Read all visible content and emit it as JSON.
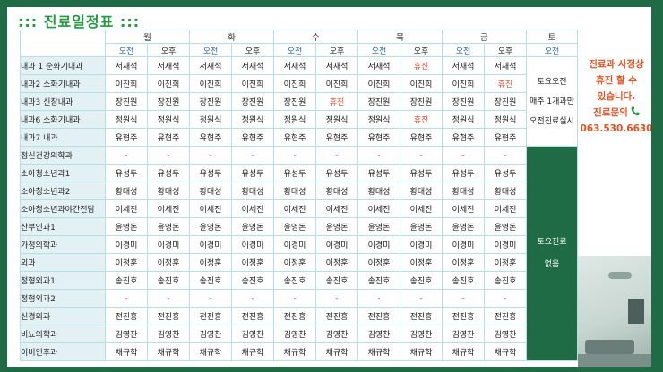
{
  "title": "::: 진료일정표 :::",
  "days": [
    "월",
    "화",
    "수",
    "목",
    "금",
    "토"
  ],
  "am_label": "오전",
  "pm_label": "오후",
  "off_label": "휴진",
  "rows": [
    {
      "dept": "내과 1 순화기내과",
      "cells": [
        "서재석",
        "서재석",
        "서재석",
        "서재석",
        "서재석",
        "서재석",
        "서재석",
        "휴진",
        "서재석",
        "서재석"
      ]
    },
    {
      "dept": "내과2 소화기내과",
      "cells": [
        "이진희",
        "이진희",
        "이진희",
        "이진희",
        "이진희",
        "이진희",
        "이진희",
        "이진희",
        "이진희",
        "휴진"
      ]
    },
    {
      "dept": "내과3 신장내과",
      "cells": [
        "장진원",
        "장진원",
        "장진원",
        "장진원",
        "장진원",
        "휴진",
        "장진원",
        "장진원",
        "장진원",
        "장진원"
      ]
    },
    {
      "dept": "내과6 소화기내과",
      "cells": [
        "정원식",
        "정원식",
        "정원식",
        "정원식",
        "정원식",
        "정원식",
        "정원식",
        "휴진",
        "정원식",
        "정원식"
      ]
    },
    {
      "dept": "내과7 내과",
      "cells": [
        "유형주",
        "유형주",
        "유형주",
        "유형주",
        "유형주",
        "유형주",
        "유형주",
        "유형주",
        "유형주",
        "유형주"
      ]
    },
    {
      "dept": "정신건강의학과",
      "cells": [
        "-",
        "-",
        "-",
        "-",
        "-",
        "-",
        "-",
        "-",
        "-",
        "-"
      ]
    },
    {
      "dept": "소아청소년과1",
      "cells": [
        "유성두",
        "유성두",
        "유성두",
        "유성두",
        "유성두",
        "유성두",
        "유성두",
        "유성두",
        "유성두",
        "유성두"
      ]
    },
    {
      "dept": "소아청소년과2",
      "cells": [
        "황대성",
        "황대성",
        "황대성",
        "황대성",
        "황대성",
        "황대성",
        "황대성",
        "황대성",
        "황대성",
        "황대성"
      ]
    },
    {
      "dept": "소아청소년과야간전담",
      "cells": [
        "이세진",
        "이세진",
        "이세진",
        "이세진",
        "이세진",
        "이세진",
        "이세진",
        "이세진",
        "이세진",
        "이세진"
      ]
    },
    {
      "dept": "산부인과1",
      "cells": [
        "윤영돈",
        "윤영돈",
        "윤영돈",
        "윤영돈",
        "윤영돈",
        "윤영돈",
        "윤영돈",
        "윤영돈",
        "윤영돈",
        "윤영돈"
      ]
    },
    {
      "dept": "가정의학과",
      "cells": [
        "이경미",
        "이경미",
        "이경미",
        "이경미",
        "이경미",
        "이경미",
        "이경미",
        "이경미",
        "이경미",
        "이경미"
      ]
    },
    {
      "dept": "외과",
      "cells": [
        "이정훈",
        "이정훈",
        "이정훈",
        "이정훈",
        "이정훈",
        "이정훈",
        "이정훈",
        "이정훈",
        "이정훈",
        "이정훈"
      ]
    },
    {
      "dept": "정형외과1",
      "cells": [
        "송진호",
        "송진호",
        "송진호",
        "송진호",
        "송진호",
        "송진호",
        "송진호",
        "송진호",
        "송진호",
        "송진호"
      ]
    },
    {
      "dept": "정형외과2",
      "cells": [
        "-",
        "-",
        "-",
        "-",
        "-",
        "-",
        "-",
        "-",
        "-",
        "-"
      ]
    },
    {
      "dept": "신경외과",
      "cells": [
        "전진흥",
        "전진흥",
        "전진흥",
        "전진흥",
        "전진흥",
        "전진흥",
        "전진흥",
        "전진흥",
        "전진흥",
        "전진흥"
      ]
    },
    {
      "dept": "비뇨의학과",
      "cells": [
        "김영찬",
        "김영찬",
        "김영찬",
        "김영찬",
        "김영찬",
        "김영찬",
        "김영찬",
        "김영찬",
        "김영찬",
        "김영찬"
      ]
    },
    {
      "dept": "이비인후과",
      "cells": [
        "채규학",
        "채규학",
        "채규학",
        "채규학",
        "채규학",
        "채규학",
        "채규학",
        "채규학",
        "채규학",
        "채규학"
      ]
    }
  ],
  "saturday_note_top": [
    "토요오전",
    "매주 1개과만",
    "오전진료실시"
  ],
  "saturday_note_bottom": [
    "토요진료",
    "없음"
  ],
  "side_note": [
    "진료과 사정상",
    "휴진 할 수",
    "있습니다.",
    "진료문의"
  ],
  "phone": "063.530.6630",
  "colors": {
    "brand_green": "#1e6b45",
    "title_green": "#1f9a3c",
    "accent_orange": "#e8501e",
    "off_red": "#e0442b",
    "am_blue": "#2a5bb8",
    "dept_bg": "#e3f1f4"
  }
}
